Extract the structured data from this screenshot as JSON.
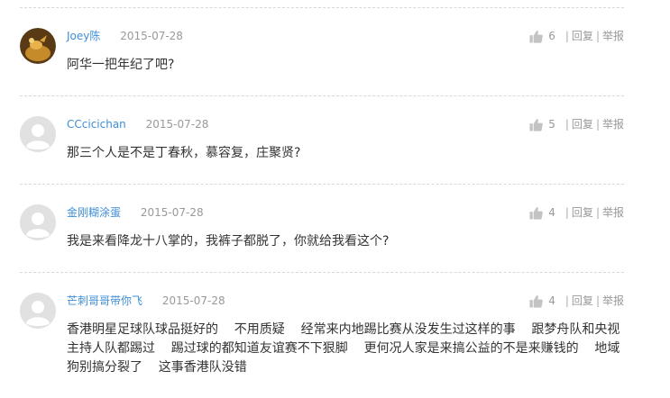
{
  "comments": [
    {
      "user": "Joey陈",
      "date": "2015-07-28",
      "likes": "6",
      "text": "阿华一把年纪了吧?",
      "avatar": "photo"
    },
    {
      "user": "CCcicichan",
      "date": "2015-07-28",
      "likes": "5",
      "text": "那三个人是不是丁春秋，慕容复，庄聚贤?",
      "avatar": "default"
    },
    {
      "user": "金刚糊涂蛋",
      "date": "2015-07-28",
      "likes": "4",
      "text": "我是来看降龙十八掌的，我裤子都脱了，你就给我看这个?",
      "avatar": "default"
    },
    {
      "user": "芒刺哥哥带你飞",
      "date": "2015-07-28",
      "likes": "4",
      "text": "香港明星足球队球品挺好的    不用质疑    经常来内地踢比赛从没发生过这样的事    跟梦舟队和央视主持人队都踢过    踢过球的都知道友谊赛不下狠脚    更何况人家是来搞公益的不是来赚钱的    地域狗别搞分裂了    这事香港队没错",
      "avatar": "default"
    }
  ],
  "actions": {
    "separator": "|",
    "reply": "回复",
    "report": "举报"
  },
  "icons": {
    "like": "thumbs-up-icon",
    "avatar_default": "default-user-avatar-icon"
  },
  "colors": {
    "username": "#3e8ed6",
    "meta": "#999999",
    "divider": "#d8d8d8"
  }
}
